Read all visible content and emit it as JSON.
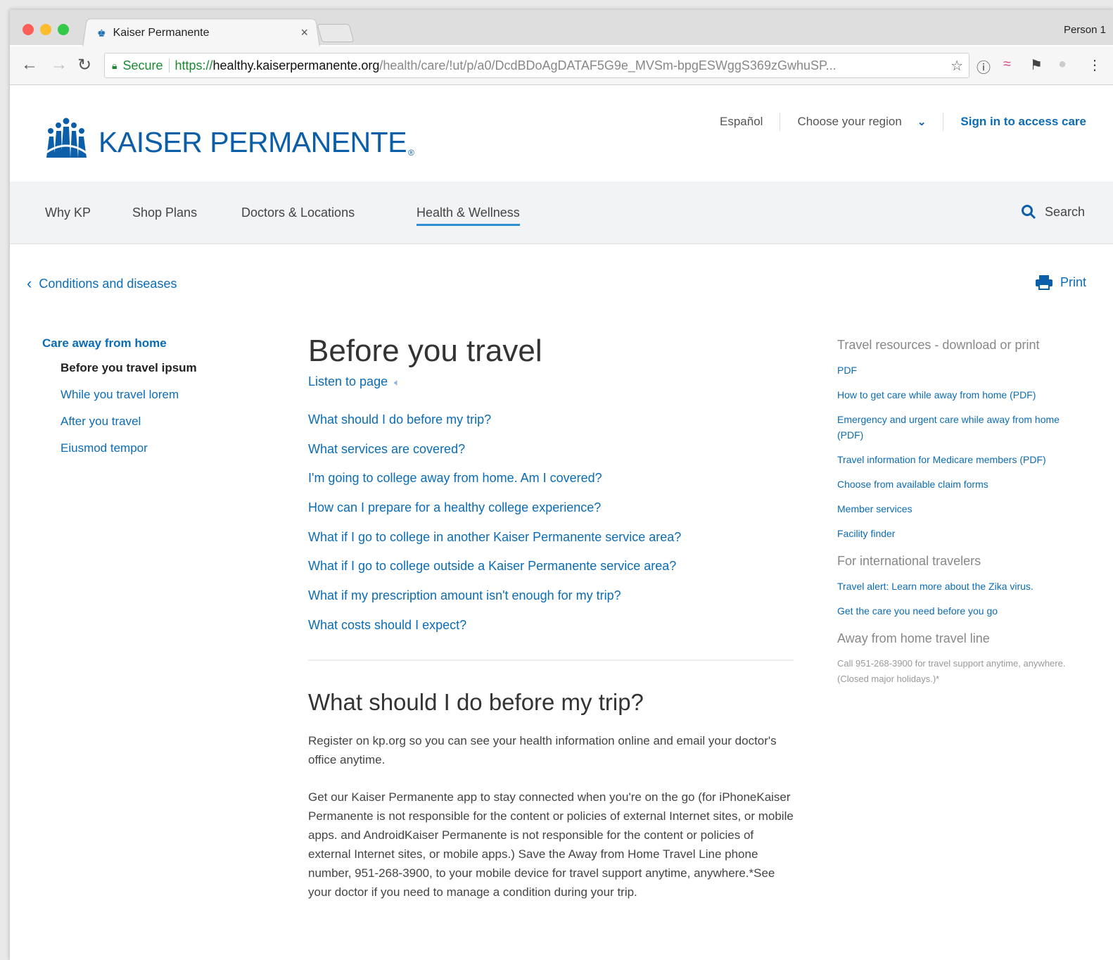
{
  "browser": {
    "tab_title": "Kaiser Permanente",
    "tab_close": "×",
    "profile": "Person 1",
    "secure_label": "Secure",
    "url_scheme": "https://",
    "url_host": "healthy.kaiserpermanente.org",
    "url_path": "/health/care/!ut/p/a0/DcdBDoAgDATAF5G9e_MVSm-bpgESWggS369zGwhuSP..."
  },
  "header": {
    "logo_text": "KAISER PERMANENTE",
    "logo_mark": "®",
    "language": "Español",
    "region": "Choose your region",
    "signin": "Sign in to access care"
  },
  "nav": {
    "items": [
      "Why KP",
      "Shop Plans",
      "Doctors & Locations",
      "Health & Wellness"
    ],
    "search": "Search"
  },
  "breadcrumb": {
    "back": "Conditions and diseases",
    "print": "Print"
  },
  "sidenav": {
    "heading": "Care away from home",
    "items": [
      "Before you travel ipsum",
      "While you travel lorem",
      "After you travel",
      "Eiusmod tempor"
    ]
  },
  "main": {
    "title": "Before you travel",
    "listen": "Listen to page",
    "toc": [
      "What should I do before my trip?",
      "What services are covered?",
      "I'm going to college away from home. Am I covered?",
      "How can I prepare for a healthy college experience?",
      "What if I go to college in another Kaiser Permanente service area?",
      "What if I go to college outside a Kaiser Permanente service area?",
      "What if my prescription amount isn't enough for my trip?",
      "What costs should I expect?"
    ],
    "section_title": "What should I do before my trip?",
    "paragraphs": [
      "Register on kp.org so you can see your health information online and email your doctor's office anytime.",
      "Get our Kaiser Permanente app to stay connected when you're on the go (for iPhoneKaiser Permanente is not responsible for the content or policies of external Internet sites, or mobile apps. and AndroidKaiser Permanente is not responsible for the content or policies of external Internet sites, or mobile apps.) Save the Away from Home Travel Line phone number, 951-268-3900, to your mobile device for travel support anytime, anywhere.*See your doctor if you need to manage a condition during your trip."
    ]
  },
  "rail": {
    "resources_heading": "Travel resources - download or print",
    "resources": [
      "PDF",
      "How to get care while away from home (PDF)",
      "Emergency and urgent care while away from home (PDF)",
      "Travel information for Medicare members (PDF)",
      "Choose from available claim forms",
      "Member services",
      "Facility finder"
    ],
    "intl_heading": "For international travelers",
    "intl_links": [
      "Travel alert: Learn more about the Zika virus.",
      "Get the care you need before you go"
    ],
    "travel_line_heading": "Away from home travel line",
    "travel_line_text": "Call 951-268-3900 for travel support anytime, anywhere. (Closed major holidays.)*"
  },
  "colors": {
    "brand_blue": "#0b5ea8",
    "link_blue": "#0b6cb6",
    "nav_active": "#2d8fd1"
  },
  "icons": [
    "kp-logo-icon",
    "search-icon",
    "print-icon",
    "chevron-left-icon",
    "chevron-down-icon",
    "speaker-icon",
    "lock-icon",
    "star-icon"
  ]
}
